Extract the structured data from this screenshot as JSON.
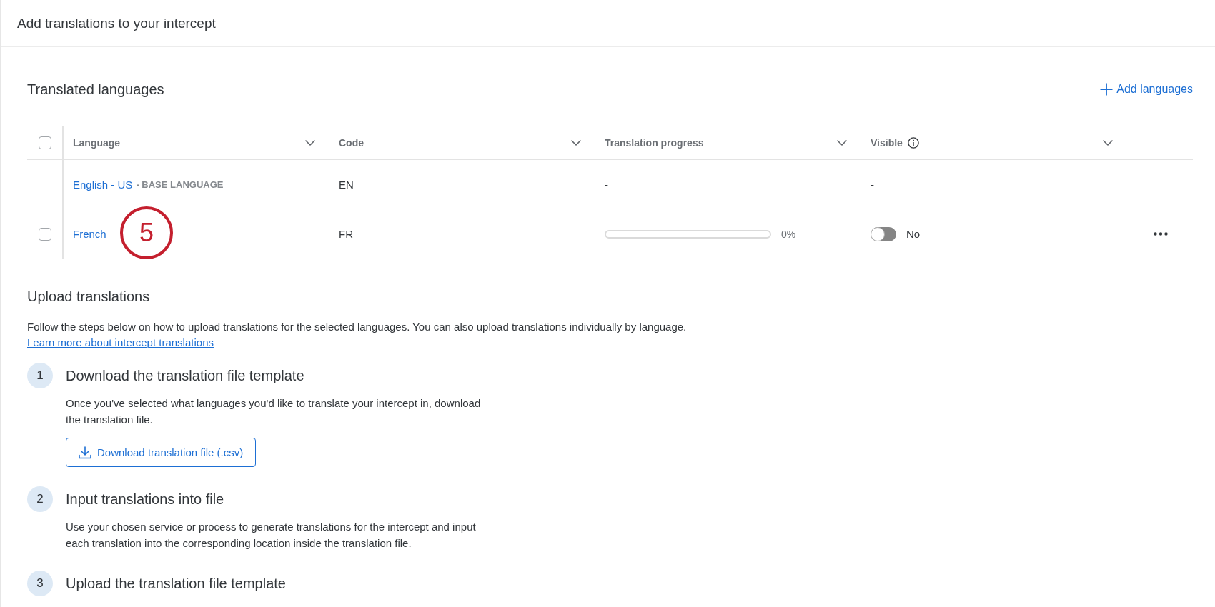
{
  "page": {
    "title": "Add translations to your intercept"
  },
  "languages_section": {
    "title": "Translated languages",
    "add_button": "Add languages"
  },
  "table": {
    "select_all": {
      "checked": false
    },
    "columns": [
      {
        "label": "Language",
        "info": false
      },
      {
        "label": "Code",
        "info": false
      },
      {
        "label": "Translation progress",
        "info": false
      },
      {
        "label": "Visible",
        "info": true
      }
    ],
    "rows": [
      {
        "kind": "base",
        "language": "English - US",
        "note": "- BASE LANGUAGE",
        "code": "EN",
        "progress_text": "-",
        "visible_text": "-"
      },
      {
        "kind": "translation",
        "checked": false,
        "language": "French",
        "code": "FR",
        "level": 0,
        "reading": "0%",
        "visible": false,
        "visible_label": "No"
      }
    ]
  },
  "annotation": {
    "label": "5"
  },
  "upload_section": {
    "title": "Upload translations",
    "intro": "Follow the steps below on how to upload translations for the selected languages. You can also upload translations individually by language.",
    "link": "Learn more about intercept translations",
    "steps": [
      {
        "number": "1",
        "title": "Download the translation file template",
        "description": "Once you've selected what languages you'd like to translate your intercept in, download the translation file.",
        "button": "Download translation file (.csv)"
      },
      {
        "number": "2",
        "title": "Input translations into file",
        "description": "Use your chosen service or process to generate translations for the intercept and input each translation into the corresponding location inside the translation file."
      },
      {
        "number": "3",
        "title": "Upload the translation file template"
      }
    ]
  }
}
